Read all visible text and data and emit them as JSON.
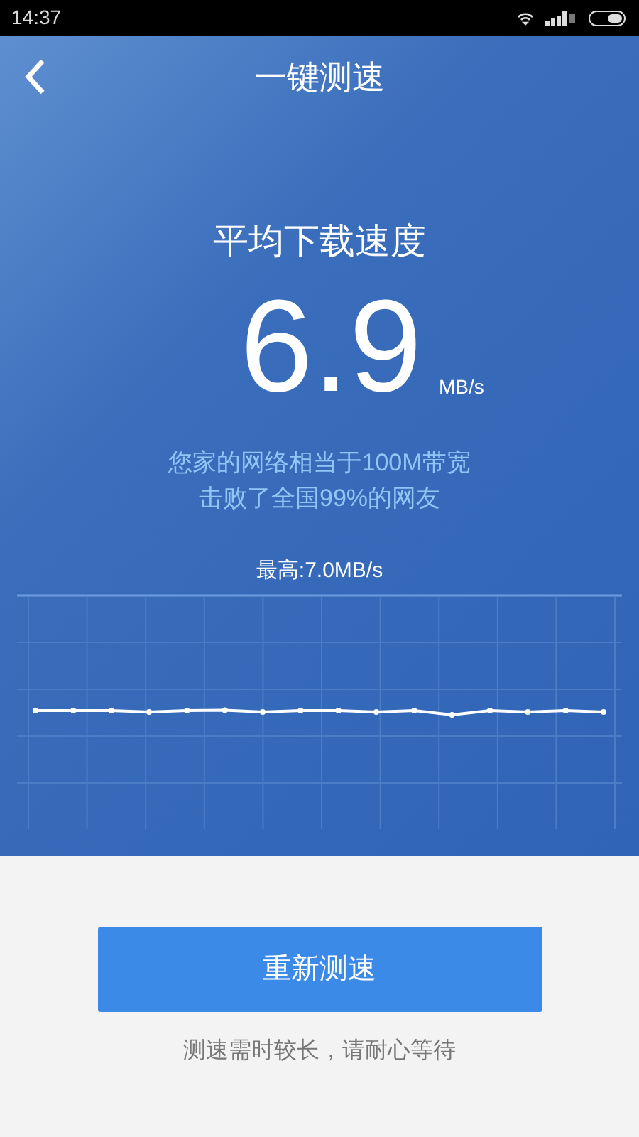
{
  "status_bar": {
    "time": "14:37"
  },
  "header": {
    "title": "一键测速"
  },
  "result": {
    "label": "平均下载速度",
    "value": "6.9",
    "unit": "MB/s",
    "lines": [
      "您家的网络相当于100M带宽",
      "击败了全国99%的网友"
    ]
  },
  "chart": {
    "peak": "最高:7.0MB/s"
  },
  "action": {
    "button": "重新测速",
    "hint": "测速需时较长，请耐心等待"
  }
}
